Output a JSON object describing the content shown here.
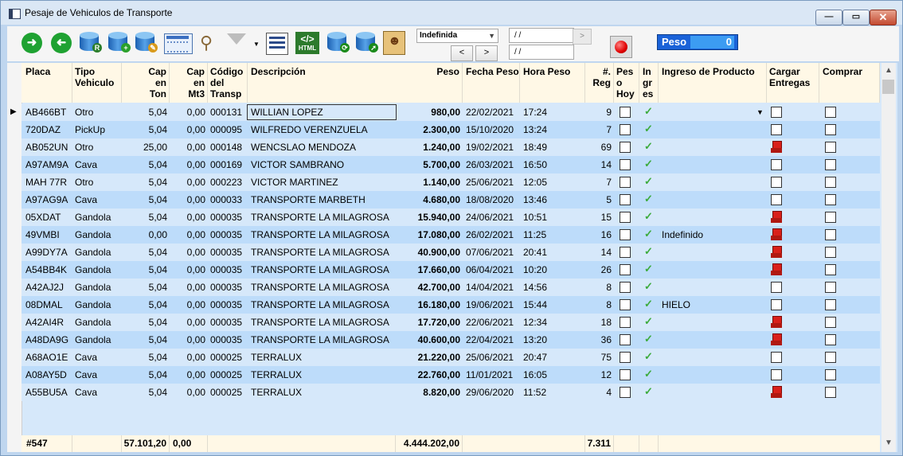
{
  "window": {
    "title": "Pesaje de Vehiculos de Transporte"
  },
  "toolbar": {
    "filter_select": "Indefinida",
    "prev_label": "<",
    "next_label": ">",
    "date_from": "/ /",
    "date_to": "/ /",
    "go_label": ">",
    "peso_label": "Peso",
    "peso_value": "0"
  },
  "columns": {
    "placa": "Placa",
    "tipo": "Tipo Vehiculo",
    "capton": "Cap en Ton",
    "capmt3": "Cap en Mt3",
    "codigo": "Código del Transp",
    "desc": "Descripción",
    "peso": "Peso",
    "fecha": "Fecha Peso",
    "hora": "Hora Peso",
    "reg": "#. Reg",
    "pesohoy": "Pes o Hoy",
    "ingres": "In gr es",
    "ingreso": "Ingreso de Producto",
    "cargar": "Cargar Entregas",
    "comprar": "Comprar"
  },
  "rows": [
    {
      "placa": "AB466BT",
      "tipo": "Otro",
      "capton": "5,04",
      "capmt3": "0,00",
      "codigo": "000131",
      "desc": "WILLIAN LOPEZ",
      "peso": "980,00",
      "fecha": "22/02/2021",
      "hora": "17:24",
      "reg": "9",
      "ingreso": "",
      "truck": false
    },
    {
      "placa": "720DAZ",
      "tipo": "PickUp",
      "capton": "5,04",
      "capmt3": "0,00",
      "codigo": "000095",
      "desc": "WILFREDO VERENZUELA",
      "peso": "2.300,00",
      "fecha": "15/10/2020",
      "hora": "13:24",
      "reg": "7",
      "ingreso": "",
      "truck": false
    },
    {
      "placa": "AB052UN",
      "tipo": "Otro",
      "capton": "25,00",
      "capmt3": "0,00",
      "codigo": "000148",
      "desc": "WENCSLAO MENDOZA",
      "peso": "1.240,00",
      "fecha": "19/02/2021",
      "hora": "18:49",
      "reg": "69",
      "ingreso": "",
      "truck": true
    },
    {
      "placa": "A97AM9A",
      "tipo": "Cava",
      "capton": "5,04",
      "capmt3": "0,00",
      "codigo": "000169",
      "desc": "VICTOR SAMBRANO",
      "peso": "5.700,00",
      "fecha": "26/03/2021",
      "hora": "16:50",
      "reg": "14",
      "ingreso": "",
      "truck": false
    },
    {
      "placa": "MAH 77R",
      "tipo": "Otro",
      "capton": "5,04",
      "capmt3": "0,00",
      "codigo": "000223",
      "desc": "VICTOR MARTINEZ",
      "peso": "1.140,00",
      "fecha": "25/06/2021",
      "hora": "12:05",
      "reg": "7",
      "ingreso": "",
      "truck": false
    },
    {
      "placa": "A97AG9A",
      "tipo": "Cava",
      "capton": "5,04",
      "capmt3": "0,00",
      "codigo": "000033",
      "desc": "TRANSPORTE MARBETH",
      "peso": "4.680,00",
      "fecha": "18/08/2020",
      "hora": "13:46",
      "reg": "5",
      "ingreso": "",
      "truck": false
    },
    {
      "placa": "05XDAT",
      "tipo": "Gandola",
      "capton": "5,04",
      "capmt3": "0,00",
      "codigo": "000035",
      "desc": "TRANSPORTE LA MILAGROSA",
      "peso": "15.940,00",
      "fecha": "24/06/2021",
      "hora": "10:51",
      "reg": "15",
      "ingreso": "",
      "truck": true
    },
    {
      "placa": "49VMBI",
      "tipo": "Gandola",
      "capton": "0,00",
      "capmt3": "0,00",
      "codigo": "000035",
      "desc": "TRANSPORTE LA MILAGROSA",
      "peso": "17.080,00",
      "fecha": "26/02/2021",
      "hora": "11:25",
      "reg": "16",
      "ingreso": "Indefinido",
      "truck": true
    },
    {
      "placa": "A99DY7A",
      "tipo": "Gandola",
      "capton": "5,04",
      "capmt3": "0,00",
      "codigo": "000035",
      "desc": "TRANSPORTE LA MILAGROSA",
      "peso": "40.900,00",
      "fecha": "07/06/2021",
      "hora": "20:41",
      "reg": "14",
      "ingreso": "",
      "truck": true
    },
    {
      "placa": "A54BB4K",
      "tipo": "Gandola",
      "capton": "5,04",
      "capmt3": "0,00",
      "codigo": "000035",
      "desc": "TRANSPORTE LA MILAGROSA",
      "peso": "17.660,00",
      "fecha": "06/04/2021",
      "hora": "10:20",
      "reg": "26",
      "ingreso": "",
      "truck": true
    },
    {
      "placa": "A42AJ2J",
      "tipo": "Gandola",
      "capton": "5,04",
      "capmt3": "0,00",
      "codigo": "000035",
      "desc": "TRANSPORTE LA MILAGROSA",
      "peso": "42.700,00",
      "fecha": "14/04/2021",
      "hora": "14:56",
      "reg": "8",
      "ingreso": "",
      "truck": false
    },
    {
      "placa": "08DMAL",
      "tipo": "Gandola",
      "capton": "5,04",
      "capmt3": "0,00",
      "codigo": "000035",
      "desc": "TRANSPORTE LA MILAGROSA",
      "peso": "16.180,00",
      "fecha": "19/06/2021",
      "hora": "15:44",
      "reg": "8",
      "ingreso": "HIELO",
      "truck": false
    },
    {
      "placa": "A42AI4R",
      "tipo": "Gandola",
      "capton": "5,04",
      "capmt3": "0,00",
      "codigo": "000035",
      "desc": "TRANSPORTE LA MILAGROSA",
      "peso": "17.720,00",
      "fecha": "22/06/2021",
      "hora": "12:34",
      "reg": "18",
      "ingreso": "",
      "truck": true
    },
    {
      "placa": "A48DA9G",
      "tipo": "Gandola",
      "capton": "5,04",
      "capmt3": "0,00",
      "codigo": "000035",
      "desc": "TRANSPORTE LA MILAGROSA",
      "peso": "40.600,00",
      "fecha": "22/04/2021",
      "hora": "13:20",
      "reg": "36",
      "ingreso": "",
      "truck": true
    },
    {
      "placa": "A68AO1E",
      "tipo": "Cava",
      "capton": "5,04",
      "capmt3": "0,00",
      "codigo": "000025",
      "desc": "TERRALUX",
      "peso": "21.220,00",
      "fecha": "25/06/2021",
      "hora": "20:47",
      "reg": "75",
      "ingreso": "",
      "truck": false
    },
    {
      "placa": "A08AY5D",
      "tipo": "Cava",
      "capton": "5,04",
      "capmt3": "0,00",
      "codigo": "000025",
      "desc": "TERRALUX",
      "peso": "22.760,00",
      "fecha": "11/01/2021",
      "hora": "16:05",
      "reg": "12",
      "ingreso": "",
      "truck": false
    },
    {
      "placa": "A55BU5A",
      "tipo": "Cava",
      "capton": "5,04",
      "capmt3": "0,00",
      "codigo": "000025",
      "desc": "TERRALUX",
      "peso": "8.820,00",
      "fecha": "29/06/2020",
      "hora": "11:52",
      "reg": "4",
      "ingreso": "",
      "truck": true
    }
  ],
  "footer": {
    "count": "#547",
    "capton": "57.101,20",
    "capmt3": "0,00",
    "peso": "4.444.202,00",
    "reg": "7.311"
  },
  "colors": {
    "header_bg": "#fff8e6",
    "row_alt": "#bddcfa",
    "row": "#d6e8fa",
    "accent": "#1a62d8"
  }
}
